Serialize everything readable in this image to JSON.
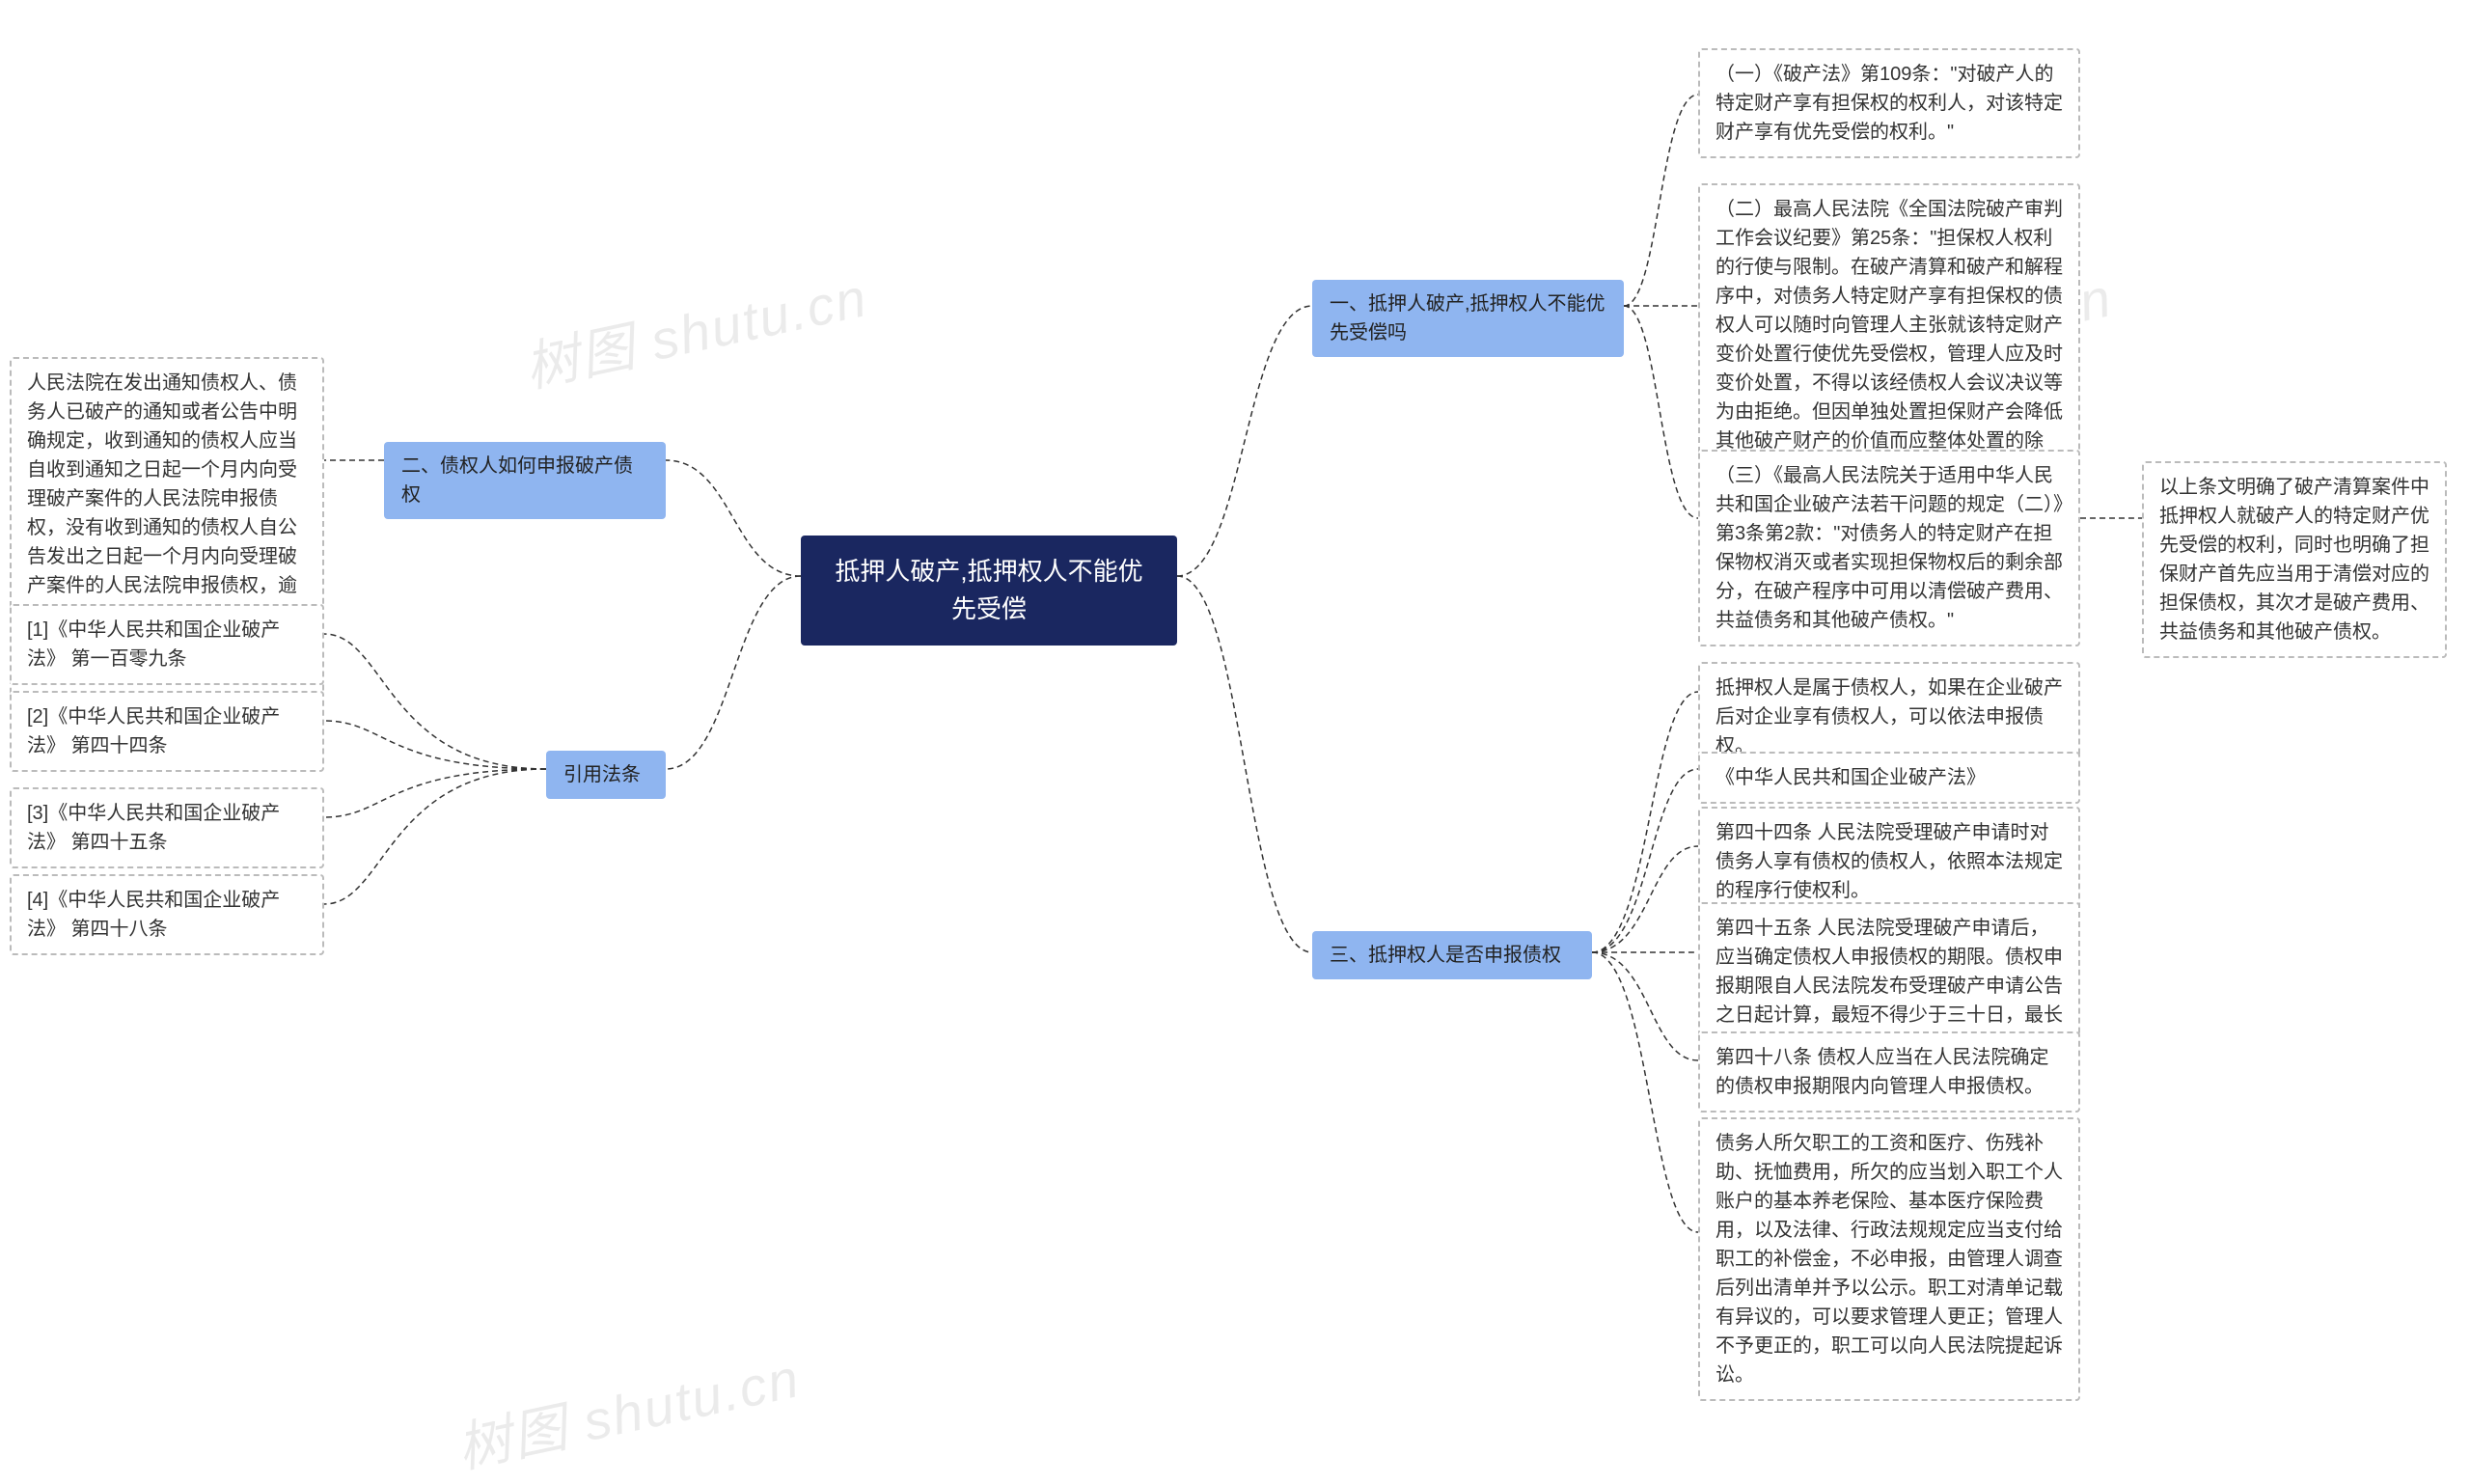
{
  "watermarks": [
    "树图 shutu.cn",
    "树图 shutu.cn",
    "树图 shutu.cn"
  ],
  "root": {
    "title": "抵押人破产,抵押权人不能优先受偿"
  },
  "right": {
    "b1": {
      "label": "一、抵押人破产,抵押权人不能优先受偿吗",
      "children": [
        {
          "text": "（一）《破产法》第109条：\"对破产人的特定财产享有担保权的权利人，对该特定财产享有优先受偿的权利。\""
        },
        {
          "text": "（二）最高人民法院《全国法院破产审判工作会议纪要》第25条：\"担保权人权利的行使与限制。在破产清算和破产和解程序中，对债务人特定财产享有担保权的债权人可以随时向管理人主张就该特定财产变价处置行使优先受偿权，管理人应及时变价处置，不得以该经债权人会议决议等为由拒绝。但因单独处置担保财产会降低其他破产财产的价值而应整体处置的除外。\""
        },
        {
          "text": "（三）《最高人民法院关于适用中华人民共和国企业破产法若干问题的规定（二）》第3条第2款：\"对债务人的特定财产在担保物权消灭或者实现担保物权后的剩余部分，在破产程序中可用以清偿破产费用、共益债务和其他破产债权。\"",
          "sub": "以上条文明确了破产清算案件中抵押权人就破产人的特定财产优先受偿的权利，同时也明确了担保财产首先应当用于清偿对应的担保债权，其次才是破产费用、共益债务和其他破产债权。"
        }
      ]
    },
    "b3": {
      "label": "三、抵押权人是否申报债权",
      "children": [
        {
          "text": "抵押权人是属于债权人，如果在企业破产后对企业享有债权人，可以依法申报债权。"
        },
        {
          "text": "《中华人民共和国企业破产法》"
        },
        {
          "text": "第四十四条 人民法院受理破产申请时对债务人享有债权的债权人，依照本法规定的程序行使权利。"
        },
        {
          "text": "第四十五条 人民法院受理破产申请后，应当确定债权人申报债权的期限。债权申报期限自人民法院发布受理破产申请公告之日起计算，最短不得少于三十日，最长不得超过三个月。"
        },
        {
          "text": "第四十八条 债权人应当在人民法院确定的债权申报期限内向管理人申报债权。"
        },
        {
          "text": "债务人所欠职工的工资和医疗、伤残补助、抚恤费用，所欠的应当划入职工个人账户的基本养老保险、基本医疗保险费用，以及法律、行政法规规定应当支付给职工的补偿金，不必申报，由管理人调查后列出清单并予以公示。职工对清单记载有异议的，可以要求管理人更正；管理人不予更正的，职工可以向人民法院提起诉讼。"
        }
      ]
    }
  },
  "left": {
    "b2": {
      "label": "二、债权人如何申报破产债权",
      "child": "人民法院在发出通知债权人、债务人已破产的通知或者公告中明确规定，收到通知的债权人应当自收到通知之日起一个月内向受理破产案件的人民法院申报债权，没有收到通知的债权人自公告发出之日起一个月内向受理破产案件的人民法院申报债权，逾期未申报的，视为放弃债权，责任由自己承担，其意味着债权的丧失。"
    },
    "b4": {
      "label": "引用法条",
      "children": [
        {
          "text": "[1]《中华人民共和国企业破产法》 第一百零九条"
        },
        {
          "text": "[2]《中华人民共和国企业破产法》 第四十四条"
        },
        {
          "text": "[3]《中华人民共和国企业破产法》 第四十五条"
        },
        {
          "text": "[4]《中华人民共和国企业破产法》 第四十八条"
        }
      ]
    }
  }
}
